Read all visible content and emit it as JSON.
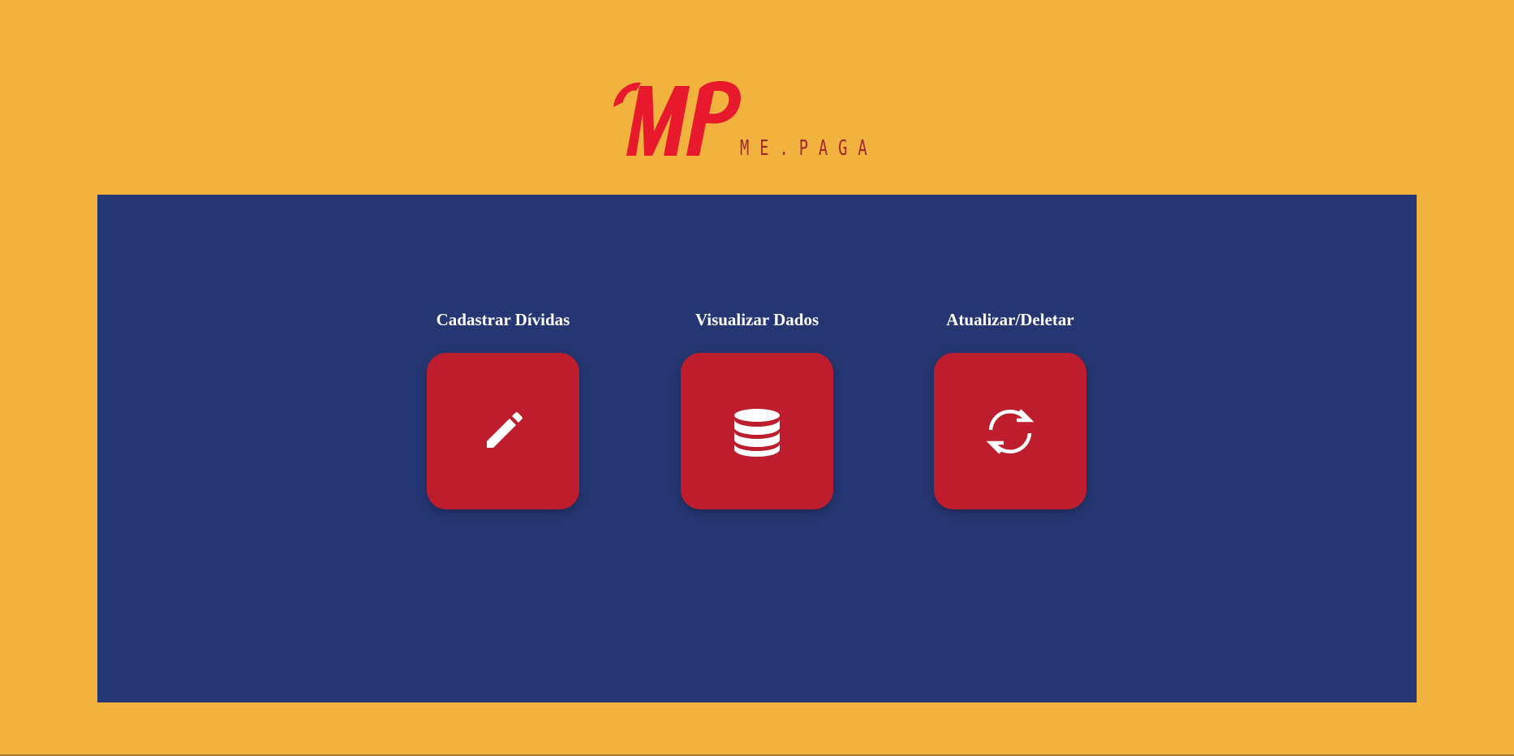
{
  "brand": {
    "logo_monogram": "MP",
    "tagline": "ME.PAGA",
    "monogram_color": "#e8192c",
    "tagline_color": "#a2272d"
  },
  "colors": {
    "page_background": "#f2b33e",
    "panel_background": "#253672",
    "button_background": "#be1d2d",
    "label_text": "#ffffff"
  },
  "actions": [
    {
      "label": "Cadastrar Dívidas",
      "icon": "pencil-icon"
    },
    {
      "label": "Visualizar Dados",
      "icon": "database-icon"
    },
    {
      "label": "Atualizar/Deletar",
      "icon": "refresh-icon"
    }
  ]
}
